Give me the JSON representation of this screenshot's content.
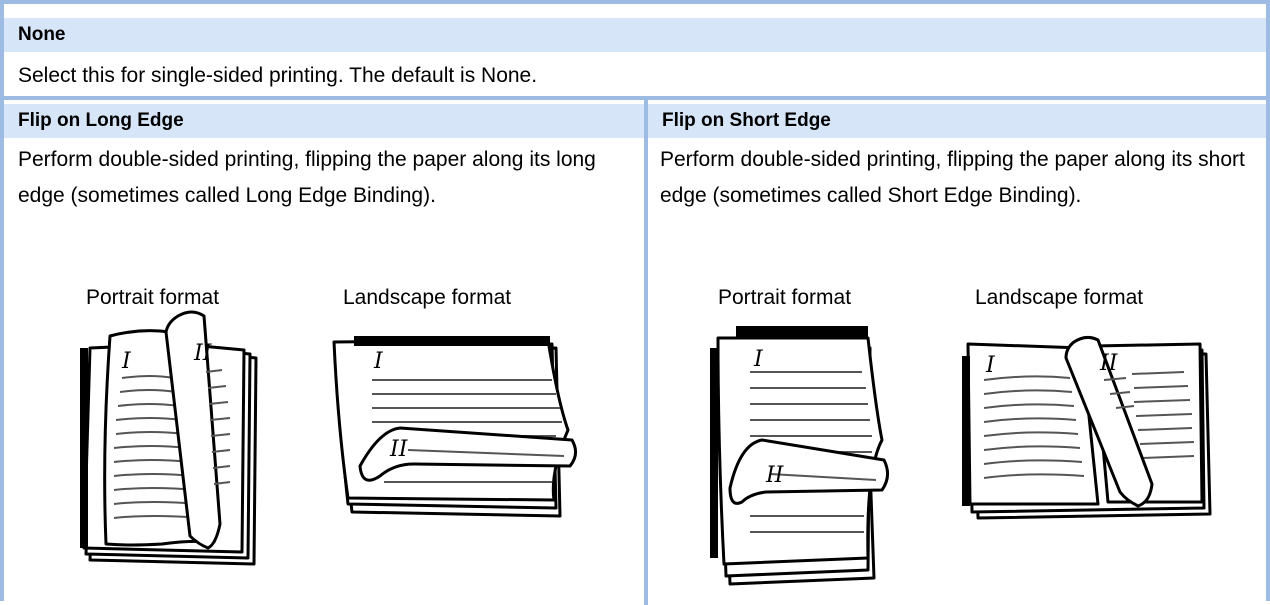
{
  "none_section": {
    "title": "None",
    "description": "Select this for single-sided printing. The default is None."
  },
  "long_edge": {
    "title": "Flip on Long Edge",
    "description": "Perform double-sided printing, flipping the paper along its long edge (sometimes called Long Edge Binding).",
    "portrait_caption": "Portrait format",
    "landscape_caption": "Landscape format",
    "page_marks": [
      "I",
      "II"
    ]
  },
  "short_edge": {
    "title": "Flip on Short Edge",
    "description": "Perform double-sided printing, flipping the paper along its short edge (sometimes called Short Edge Binding).",
    "portrait_caption": "Portrait format",
    "landscape_caption": "Landscape format",
    "page_marks": [
      "I",
      "II"
    ]
  },
  "colors": {
    "header_background": "#d6e5f8",
    "border": "#9dbbe3"
  }
}
